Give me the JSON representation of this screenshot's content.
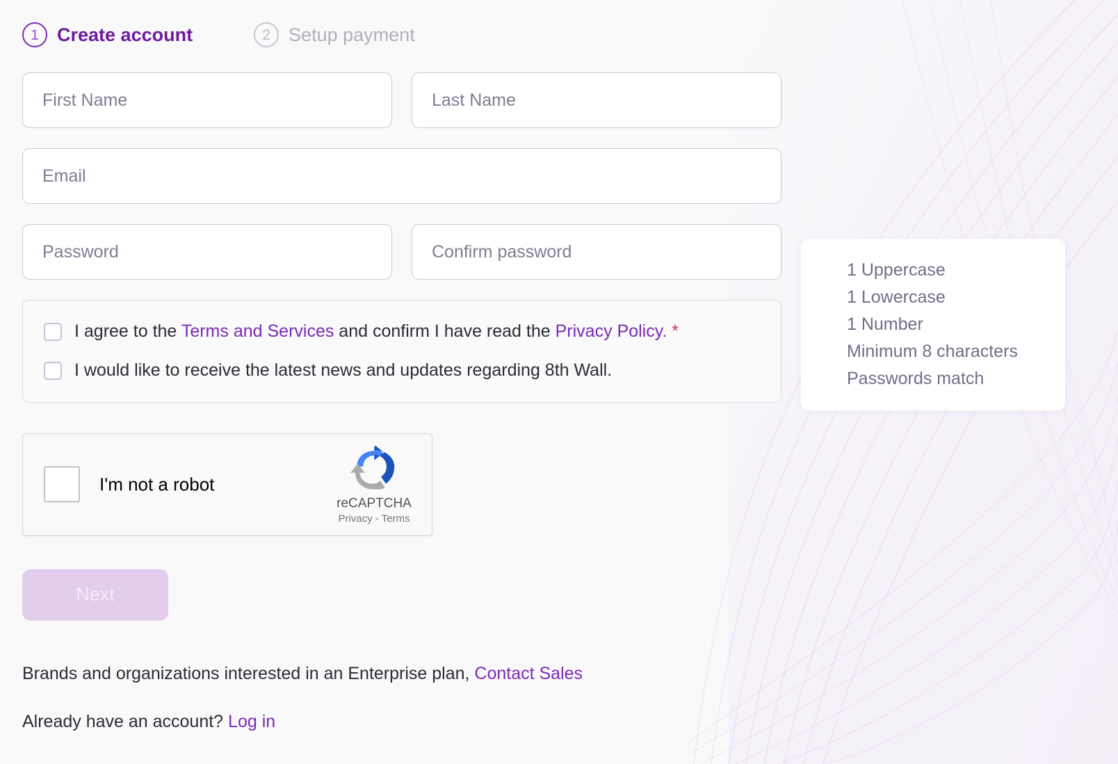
{
  "theme": {
    "page_bg": "#f9f9fa",
    "accent_purple": "#7b2ab5",
    "accent_purple_light": "#9d4edd",
    "muted_gray": "#b0b0bd",
    "asterisk_red": "#d6326b",
    "next_disabled_bg": "#e2cdec"
  },
  "stepper": {
    "steps": [
      {
        "number": "1",
        "label": "Create account",
        "state": "active"
      },
      {
        "number": "2",
        "label": "Setup payment",
        "state": "inactive"
      }
    ]
  },
  "form": {
    "first_name": {
      "placeholder": "First Name",
      "value": ""
    },
    "last_name": {
      "placeholder": "Last Name",
      "value": ""
    },
    "email": {
      "placeholder": "Email",
      "value": ""
    },
    "password": {
      "placeholder": "Password",
      "value": ""
    },
    "confirm_password": {
      "placeholder": "Confirm password",
      "value": ""
    }
  },
  "consent": {
    "terms": {
      "checked": false,
      "text_before": "I agree to the ",
      "link_terms": "Terms and Services",
      "text_middle": " and confirm I have read the ",
      "link_privacy": "Privacy Policy",
      "text_after": ".",
      "required_marker": "*"
    },
    "newsletter": {
      "checked": false,
      "text": "I would like to receive the latest news and updates regarding 8th Wall."
    }
  },
  "recaptcha": {
    "checked": false,
    "label": "I'm not a robot",
    "brand": "reCAPTCHA",
    "links": "Privacy - Terms",
    "logo_icon": "recaptcha-arrows-icon"
  },
  "actions": {
    "next_label": "Next",
    "next_disabled": true
  },
  "password_rules": {
    "items": [
      "1 Uppercase",
      "1 Lowercase",
      "1 Number",
      "Minimum 8 characters",
      "Passwords match"
    ]
  },
  "footer": {
    "enterprise_text": "Brands and organizations interested in an Enterprise plan, ",
    "contact_sales_link": "Contact Sales",
    "account_text": "Already have an account? ",
    "login_link": "Log in"
  }
}
